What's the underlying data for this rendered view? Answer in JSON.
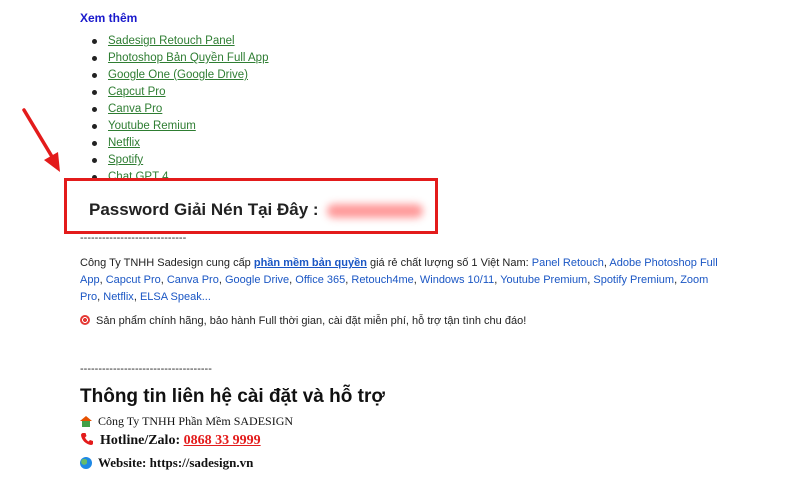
{
  "see_more": {
    "heading": "Xem thêm"
  },
  "links": [
    "Sadesign Retouch Panel",
    "Photoshop Bản Quyền Full App",
    "Google One (Google Drive)",
    "Capcut Pro",
    "Canva Pro",
    "Youtube Remium",
    "Netflix",
    "Spotify",
    "Chat GPT 4"
  ],
  "password_box": {
    "label": "Password Giải Nén Tại Đây :",
    "value_hidden": "sadesign.vn"
  },
  "divider1": "-----------------------------",
  "company_paragraph": {
    "intro": "Công Ty TNHH Sadesign cung cấp ",
    "highlight": "phần mềm bản quyền",
    "middle": " giá rẻ chất lượng số 1 Việt Nam: ",
    "products": [
      "Panel Retouch",
      "Adobe Photoshop Full App",
      "Capcut Pro",
      "Canva Pro",
      "Google Drive",
      "Office 365",
      "Retouch4me",
      "Windows 10/11",
      "Youtube Premium",
      "Spotify Premium",
      "Zoom Pro",
      "Netflix",
      "ELSA Speak..."
    ]
  },
  "guarantee": "Sản phẩm chính hãng, bảo hành Full thời gian, cài đặt miễn phí, hỗ trợ tận tình chu đáo!",
  "divider2": "------------------------------------",
  "contact": {
    "heading": "Thông tin liên hệ cài đặt và hỗ trợ",
    "company": "Công Ty TNHH Phần Mềm SADESIGN",
    "hotline_label": "Hotline/Zalo:",
    "hotline_number": "0868 33 9999",
    "website_label": "Website:",
    "website_url": "https://sadesign.vn"
  },
  "colors": {
    "highlight_box": "#e31b1b",
    "link_green": "#2e7d32",
    "link_blue": "#1a56c4"
  }
}
